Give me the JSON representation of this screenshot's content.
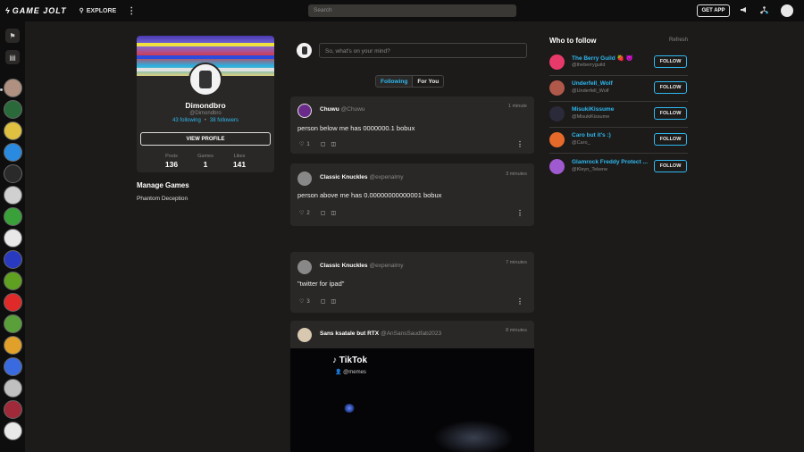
{
  "topbar": {
    "logo": "GAME JOLT",
    "explore": "EXPLORE",
    "search_placeholder": "Search",
    "get_app": "GET APP"
  },
  "profile": {
    "name": "Dimondbro",
    "handle": "@Dimondbro",
    "following": "43 following",
    "followers": "38 followers",
    "view_profile": "VIEW PROFILE",
    "stats": [
      {
        "label": "Posts",
        "value": "136"
      },
      {
        "label": "Games",
        "value": "1"
      },
      {
        "label": "Likes",
        "value": "141"
      }
    ]
  },
  "manage": {
    "title": "Manage Games",
    "items": [
      "Phantom Deception"
    ]
  },
  "composer": {
    "placeholder": "So, what's on your mind?"
  },
  "tabs": [
    {
      "label": "Following",
      "active": true
    },
    {
      "label": "For You",
      "active": false
    }
  ],
  "posts": [
    {
      "author": "Chuwu",
      "handle": "@Chuwu",
      "time": "1 minute",
      "body": "person below me has 0000000.1 bobux",
      "likes": "1",
      "avatar_color": "#6a2a8a"
    },
    {
      "author": "Classic Knuckles",
      "handle": "@expenalmy",
      "time": "3 minutes",
      "body": "person above me has 0.00000000000001 bobux",
      "likes": "2",
      "avatar_color": "#888888"
    },
    {
      "author": "Classic Knuckles",
      "handle": "@expenalmy",
      "time": "7 minutes",
      "body": "\"twitter for ipad\"",
      "likes": "3",
      "avatar_color": "#888888"
    },
    {
      "author": "Sans ksatale but RTX",
      "handle": "@AnSansSaudfab2023",
      "time": "8 minutes",
      "video_title": "TikTok",
      "video_handle": "@memes",
      "avatar_color": "#d8c8b0"
    }
  ],
  "who_to_follow": {
    "title": "Who to follow",
    "refresh": "Refresh",
    "follow_label": "FOLLOW",
    "users": [
      {
        "name": "The Berry Guild 🍓 😈",
        "handle": "@theberryguild",
        "color": "#e83a6a"
      },
      {
        "name": "Underfell_Wolf",
        "handle": "@Underfell_Wolf",
        "color": "#b0584a"
      },
      {
        "name": "MisukiKissume",
        "handle": "@MisukiKissume",
        "color": "#2a2a3a"
      },
      {
        "name": "Caro but it's :)",
        "handle": "@Caro_",
        "color": "#e86a2a"
      },
      {
        "name": "Glamrock Freddy Protect ...",
        "handle": "@Kleyn_Tekene",
        "color": "#a05ad0"
      }
    ]
  },
  "colors": {
    "accent": "#2eb8f0",
    "background": "#1d1b19",
    "card": "#2a2826",
    "topbar": "#0e0e0e"
  }
}
